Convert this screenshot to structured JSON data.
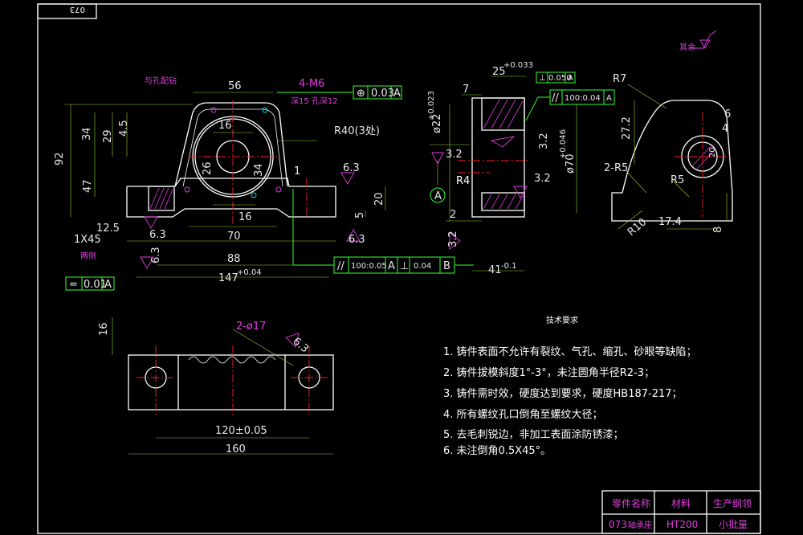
{
  "title_block": {
    "corner_code": "073",
    "part_name_label": "零件名称",
    "part_name": "073",
    "part_name_suffix": "轴承座",
    "material_label": "材料",
    "material": "HT200",
    "production_label": "生产纲领",
    "production": "小批量"
  },
  "front_view": {
    "dims": {
      "d56": "56",
      "d4m6": "4-M6",
      "deep": "深15 孔深12",
      "d34_left": "34",
      "d29": "29",
      "d45": "4.5",
      "d92": "92",
      "d47": "47",
      "d16_top": "16",
      "d26": "26",
      "d34_mid": "34",
      "r40": "R40(3处)",
      "d1": "1",
      "d63_a": "6.3",
      "d20": "20",
      "d5": "5",
      "d16_bot": "16",
      "d70": "70",
      "d88": "88",
      "d147": "147",
      "d125": "12.5",
      "d1x45": "1X45",
      "d63_b": "6.3",
      "d63_c": "6.3",
      "d63_d": "6.3",
      "tol_sym": "0.01",
      "tol_sym_datum": "A",
      "tol_pos": "0.03",
      "tol_pos_datum": "A",
      "callout_hole": "与孔配钻",
      "d147_tol": "+0.04",
      "note_left": "两侧"
    }
  },
  "side_view": {
    "dims": {
      "d25": "25",
      "d25_tol": "+0.033",
      "tol_perp": "0.050",
      "tol_perp_datum": "A",
      "tol_par": "100:0.04",
      "tol_par_datum": "A",
      "d7": "7",
      "d22": "ø22",
      "d22_tol": "+0.023",
      "d32a": "3.2",
      "d32b": "3.2",
      "d32c": "3.2",
      "d32d": "3.2",
      "d70": "ø70",
      "d70_tol": "+0.046",
      "r4": "R4",
      "d2": "2",
      "datum_a": "A",
      "tol_bottom_par": "100:0.05",
      "tol_bottom_par_datum": "A",
      "tol_bottom_perp": "0.04",
      "tol_bottom_perp_datum": "B",
      "d41": "41",
      "d41_tol": "-0.1"
    }
  },
  "right_view": {
    "dims": {
      "r7": "R7",
      "d6": "6",
      "d272": "27.2",
      "d4": "4",
      "d2r5": "2-R5",
      "r5": "R5",
      "d20": "20",
      "r10": "R10",
      "d174": "17.4",
      "d8": "8",
      "roughness": "其余"
    }
  },
  "top_view": {
    "dims": {
      "d16": "16",
      "d2017": "2-ø17",
      "d63": "6.3",
      "d120": "120±0.05",
      "d160": "160"
    }
  },
  "notes": {
    "title": "技术要求",
    "items": [
      "1. 铸件表面不允许有裂纹、气孔、缩孔、砂眼等缺陷；",
      "2. 铸件拔模斜度1°-3°，未注圆角半径R2-3；",
      "3. 铸件需时效，硬度达到要求，硬度HB187-217；",
      "4. 所有螺纹孔口倒角至螺纹大径；",
      "5. 去毛刺锐边，非加工表面涂防锈漆；",
      "6. 未注倒角0.5X45°。"
    ]
  },
  "colors": {
    "background": "#000000",
    "outline": "#ffffff",
    "dimension": "#9acd32",
    "centerline": "#ff2020",
    "hatch": "#e03ce0",
    "tolerance_frame": "#33ff33"
  }
}
